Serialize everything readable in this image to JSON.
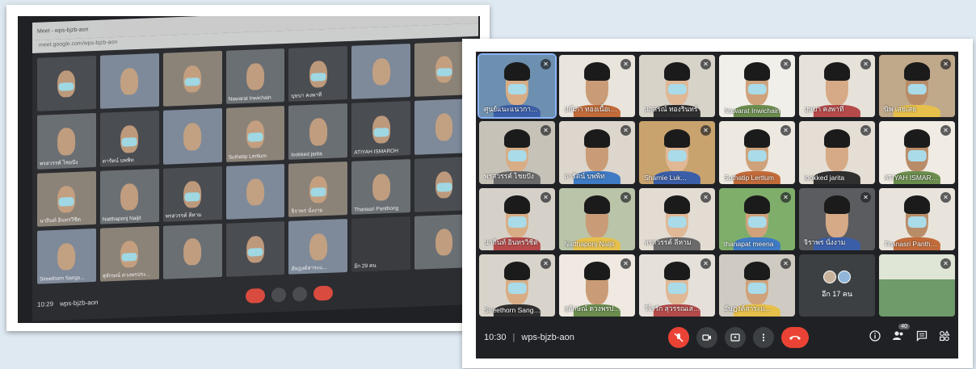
{
  "photo": {
    "tab_title": "Meet - wps-bjzb-aon",
    "url": "meet.google.com/wps-bjzb-aon",
    "time": "10:29",
    "meeting_code": "wps-bjzb-aon",
    "others_label": "อีก 29 คน",
    "names": [
      "",
      "",
      "",
      "Nawarat Inwichain",
      "บุษบา คงพาที",
      "",
      "",
      "พรสวรรค์ ไชยปัง",
      "ดารัตน์ บพพิท",
      "",
      "Suthatip Lertlum",
      "lookked jarita",
      "ATIYAH ISMAROH",
      "",
      "นาถินท์ อินทรวิชิต",
      "Natthaponj Naijit",
      "พรสวรรค์ ลีหาม",
      "",
      "จิราพร นั่งงาม",
      "Thanasri Panthong",
      "",
      "Sireethorn Sangs...",
      "สุลักษณ์ ดวงพรประ...",
      "",
      "",
      "อัษฎงค์สาระแ...",
      "",
      ""
    ]
  },
  "meet": {
    "time": "10:30",
    "meeting_code": "wps-bjzb-aon",
    "people_count": "40",
    "others_label": "อีก 17 คน",
    "participants": [
      {
        "name": "ศูนย์แนะแนวการศึกษา สพ.สพ",
        "active": true
      },
      {
        "name": "ปณิภา ทองเนื้อเพชร"
      },
      {
        "name": "นฤสรณ์ ทองรินทร์"
      },
      {
        "name": "Nawarat Inwichain"
      },
      {
        "name": "บุษบา คงพาที"
      },
      {
        "name": "นิพ เสยเสย"
      },
      {
        "name": "พรสวรรค์ ไชยปัง"
      },
      {
        "name": "ดารัตน์ บพพิท"
      },
      {
        "name": "Sharnie Luk..."
      },
      {
        "name": "Suthatip Lertlum"
      },
      {
        "name": "lookked jarita"
      },
      {
        "name": "ATIYAH ISMAROH..."
      },
      {
        "name": "นาถินท์ อินทรวิชิต"
      },
      {
        "name": "Natthaponj Naijit"
      },
      {
        "name": "พรสวรรค์ ลีหาม"
      },
      {
        "name": "thanapat meena"
      },
      {
        "name": "จิราพร นั่งงาม"
      },
      {
        "name": "Thanasri Panthong"
      },
      {
        "name": "Sireethorn Sangs..."
      },
      {
        "name": "สุลักษณ์ ดวงพรประ..."
      },
      {
        "name": "วิไรรัก สุวรรณเสรสันติ"
      },
      {
        "name": "อัษฎงค์สาระแ..."
      }
    ]
  },
  "icons": {
    "mic_off": "mic-off-icon",
    "camera": "camera-icon",
    "present": "present-icon",
    "more": "more-vert-icon",
    "end_call": "end-call-icon",
    "info": "info-icon",
    "people": "people-icon",
    "chat": "chat-icon",
    "activities": "activities-icon"
  },
  "colors": {
    "meet_bg": "#202124",
    "end_call": "#ea4335",
    "active_outline": "#8ab4f8"
  }
}
